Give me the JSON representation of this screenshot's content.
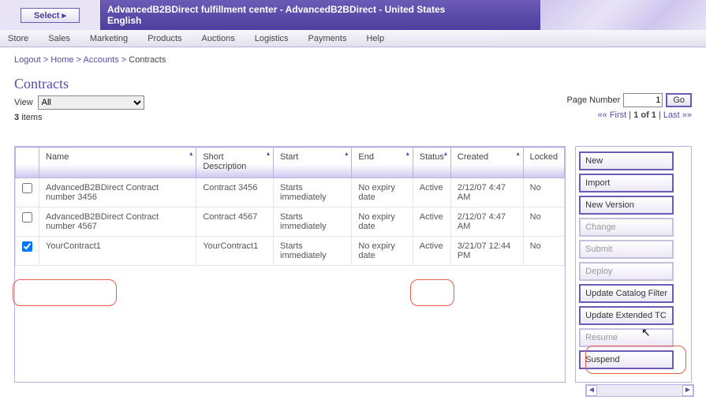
{
  "header": {
    "select_label": "Select ▸",
    "title_line1": "AdvancedB2BDirect fulfillment center - AdvancedB2BDirect - United States",
    "title_line2": "English"
  },
  "menu": [
    "Store",
    "Sales",
    "Marketing",
    "Products",
    "Auctions",
    "Logistics",
    "Payments",
    "Help"
  ],
  "breadcrumb": {
    "logout": "Logout",
    "home": "Home",
    "accounts": "Accounts",
    "current": "Contracts"
  },
  "page": {
    "title": "Contracts",
    "view_label": "View",
    "view_value": "All",
    "items_count": "3",
    "items_word": "items",
    "page_label": "Page Number",
    "page_value": "1",
    "go": "Go",
    "first": "First",
    "pg_of": "1 of 1",
    "last": "Last"
  },
  "columns": [
    "",
    "Name",
    "Short Description",
    "Start",
    "End",
    "Status",
    "Created",
    "Locked"
  ],
  "rows": [
    {
      "checked": false,
      "name": "AdvancedB2BDirect Contract number 3456",
      "desc": "Contract 3456",
      "start": "Starts immediately",
      "end": "No expiry date",
      "status": "Active",
      "created": "2/12/07 4:47 AM",
      "locked": "No"
    },
    {
      "checked": false,
      "name": "AdvancedB2BDirect Contract number 4567",
      "desc": "Contract 4567",
      "start": "Starts immediately",
      "end": "No expiry date",
      "status": "Active",
      "created": "2/12/07 4:47 AM",
      "locked": "No"
    },
    {
      "checked": true,
      "name": "YourContract1",
      "desc": "YourContract1",
      "start": "Starts immediately",
      "end": "No expiry date",
      "status": "Active",
      "created": "3/21/07 12:44 PM",
      "locked": "No"
    }
  ],
  "side": [
    {
      "label": "New",
      "enabled": true
    },
    {
      "label": "Import",
      "enabled": true
    },
    {
      "label": "New Version",
      "enabled": true
    },
    {
      "label": "Change",
      "enabled": false
    },
    {
      "label": "Submit",
      "enabled": false
    },
    {
      "label": "Deploy",
      "enabled": false
    },
    {
      "label": "Update Catalog Filter",
      "enabled": true
    },
    {
      "label": "Update Extended TC",
      "enabled": true
    },
    {
      "label": "Resume",
      "enabled": false
    },
    {
      "label": "Suspend",
      "enabled": true
    }
  ]
}
